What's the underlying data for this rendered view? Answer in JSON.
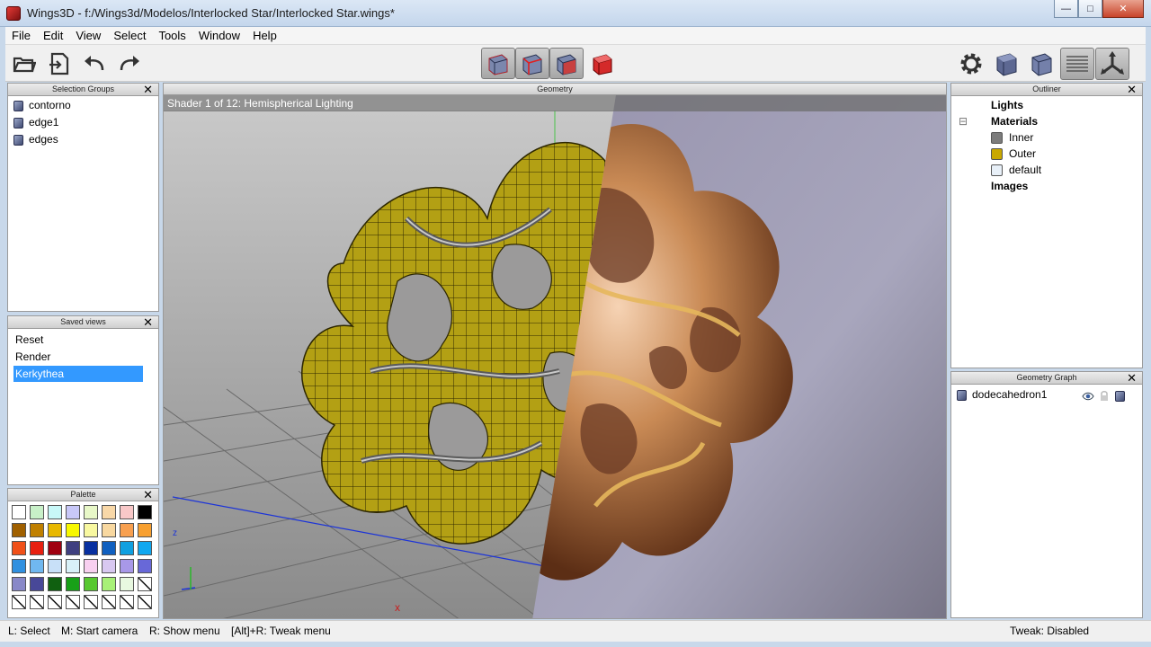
{
  "window": {
    "title": "Wings3D - f:/Wings3d/Modelos/Interlocked Star/Interlocked Star.wings*",
    "min": "—",
    "max": "□",
    "close": "✕"
  },
  "menu": [
    "File",
    "Edit",
    "View",
    "Select",
    "Tools",
    "Window",
    "Help"
  ],
  "toolbar": {
    "left": [
      "open-icon",
      "save-icon",
      "undo-icon",
      "redo-icon"
    ],
    "modes": [
      "vertex-mode-icon",
      "edge-mode-icon",
      "face-mode-icon",
      "body-mode-icon"
    ],
    "right": [
      "preferences-gear-icon",
      "shaded-view-icon",
      "perspective-icon",
      "smooth-preview-icon",
      "axes-icon"
    ]
  },
  "selection_groups": {
    "title": "Selection Groups",
    "items": [
      "contorno",
      "edge1",
      "edges"
    ]
  },
  "saved_views": {
    "title": "Saved views",
    "items": [
      "Reset",
      "Render",
      "Kerkythea"
    ],
    "selected": "Kerkythea"
  },
  "palette": {
    "title": "Palette",
    "colors": [
      "#ffffff",
      "#c8f0c8",
      "#c8f8f8",
      "#c8c8f8",
      "#e8f8c8",
      "#f8d8a8",
      "#f8c8c8",
      "#000000",
      "#a06000",
      "#c08000",
      "#e8b800",
      "#f8f800",
      "#f8f8a0",
      "#f8d8a0",
      "#f8a050",
      "#f8a030",
      "#f05018",
      "#e82010",
      "#a00010",
      "#404080",
      "#0830a0",
      "#1060c0",
      "#10a0e0",
      "#10a8f0",
      "#3090e0",
      "#70b8f0",
      "#c8e0f8",
      "#d8f0f8",
      "#f8d0f0",
      "#d8c8f0",
      "#a898e8",
      "#6868d8",
      "#8888c8",
      "#484898",
      "#106010",
      "#18a018",
      "#58c830",
      "#a8f078",
      "#e8f8e0",
      "empty",
      "empty",
      "empty",
      "empty",
      "empty",
      "empty",
      "empty",
      "empty",
      "empty"
    ]
  },
  "geometry": {
    "title": "Geometry",
    "shader_label": "Shader 1 of 12: Hemispherical Lighting"
  },
  "outliner": {
    "title": "Outliner",
    "lights": "Lights",
    "materials": "Materials",
    "items": [
      {
        "label": "Inner",
        "color": "#7c7c7c"
      },
      {
        "label": "Outer",
        "color": "#c9a800"
      },
      {
        "label": "default",
        "color": "#e8f0f8"
      }
    ],
    "images": "Images",
    "collapse": "⊟"
  },
  "geometry_graph": {
    "title": "Geometry Graph",
    "object": "dodecahedron1"
  },
  "status": {
    "select": "L: Select",
    "camera": "M: Start camera",
    "menu": "R: Show menu",
    "tweak_menu": "[Alt]+R: Tweak menu",
    "tweak": "Tweak: Disabled"
  },
  "colors": {
    "accent_selection": "#3399ff",
    "mesh_yellow": "#b3a014",
    "copper": "#c98a55",
    "render_bg": "#a09fb7"
  }
}
